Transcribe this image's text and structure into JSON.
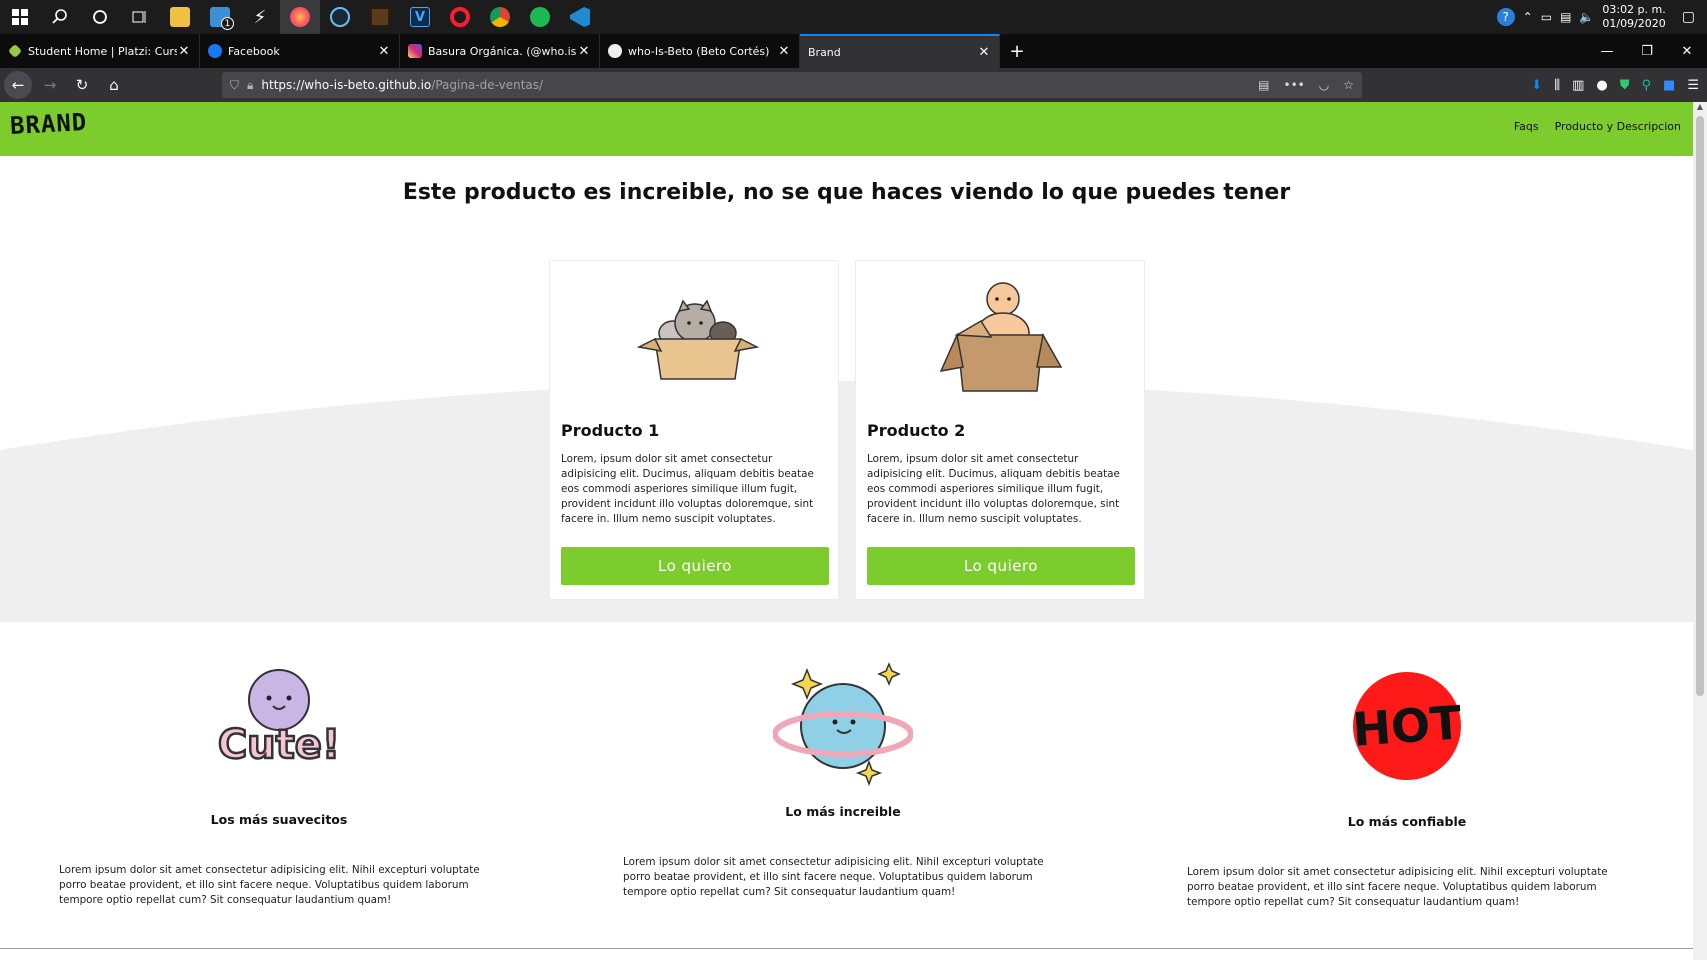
{
  "taskbar": {
    "icons": [
      "windows-icon",
      "search-icon",
      "cortana-icon",
      "task-view-icon",
      "file-explorer-icon",
      "mail-icon",
      "hyper-icon",
      "firefox-icon",
      "steam-icon",
      "minecraft-icon",
      "v-icon",
      "opera-icon",
      "chrome-icon",
      "spotify-icon",
      "vscode-icon"
    ],
    "mail_badge": "1",
    "clock_time": "03:02 p. m.",
    "clock_date": "01/09/2020"
  },
  "tabs": [
    {
      "title": "Student Home | Platzi: Cursos Online",
      "color": "#98ca3f"
    },
    {
      "title": "Facebook",
      "color": "#1877f2"
    },
    {
      "title": "Basura Orgánica. (@who.is.beto)",
      "color": "#d62976"
    },
    {
      "title": "who-Is-Beto (Beto Cortés)",
      "color": "#f0f0f0"
    },
    {
      "title": "Brand",
      "color": "#323234"
    }
  ],
  "nav": {
    "url_host": "https://who-is-beto.github.io",
    "url_path": "/Pagina-de-ventas/"
  },
  "site": {
    "logo": "BRAND",
    "nav_items": [
      "Faqs",
      "Producto y Descripcion"
    ],
    "hero_title": "Este producto es increible, no se que haces viendo lo que puedes tener",
    "products": [
      {
        "title": "Producto 1",
        "text": "Lorem, ipsum dolor sit amet consectetur adipisicing elit. Ducimus, aliquam debitis beatae eos commodi asperiores similique illum fugit, provident incidunt illo voluptas doloremque, sint facere in. Illum nemo suscipit voluptates.",
        "button": "Lo quiero"
      },
      {
        "title": "Producto 2",
        "text": "Lorem, ipsum dolor sit amet consectetur adipisicing elit. Ducimus, aliquam debitis beatae eos commodi asperiores similique illum fugit, provident incidunt illo voluptas doloremque, sint facere in. Illum nemo suscipit voluptates.",
        "button": "Lo quiero"
      }
    ],
    "features": [
      {
        "title": "Los más suavecitos",
        "text": "Lorem ipsum dolor sit amet consectetur adipisicing elit. Nihil excepturi voluptate porro beatae provident, et illo sint facere neque. Voluptatibus quidem laborum tempore optio repellat cum? Sit consequatur laudantium quam!",
        "sticker": "Cute!"
      },
      {
        "title": "Lo más increible",
        "text": "Lorem ipsum dolor sit amet consectetur adipisicing elit. Nihil excepturi voluptate porro beatae provident, et illo sint facere neque. Voluptatibus quidem laborum tempore optio repellat cum? Sit consequatur laudantium quam!"
      },
      {
        "title": "Lo más confiable",
        "text": "Lorem ipsum dolor sit amet consectetur adipisicing elit. Nihil excepturi voluptate porro beatae provident, et illo sint facere neque. Voluptatibus quidem laborum tempore optio repellat cum? Sit consequatur laudantium quam!",
        "sticker": "HOT"
      }
    ]
  },
  "colors": {
    "brand_green": "#7ccc2d",
    "grey_band": "#efefef"
  }
}
